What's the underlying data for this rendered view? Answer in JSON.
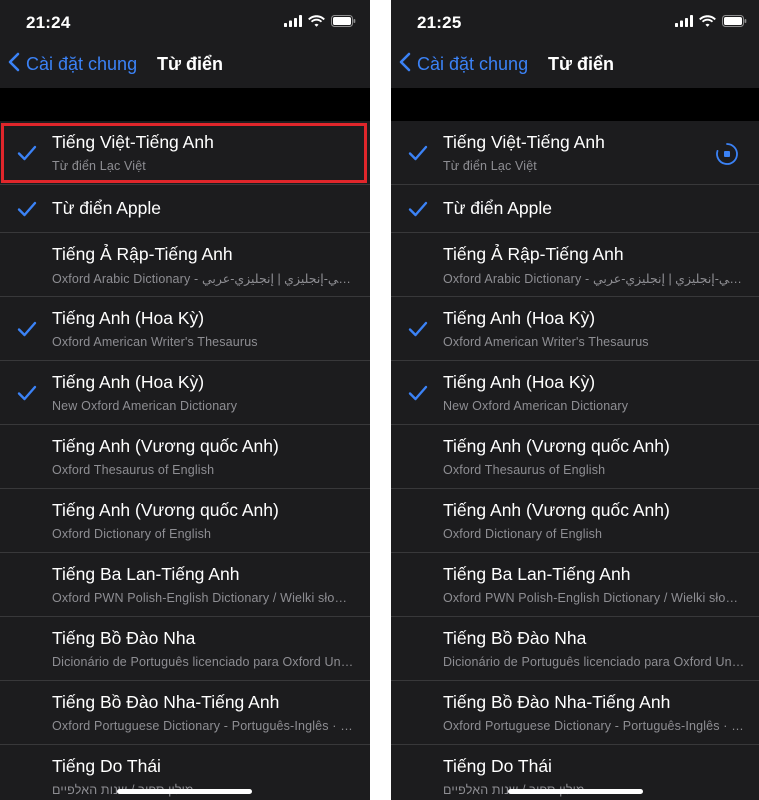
{
  "left": {
    "status_time": "21:24",
    "nav_back_label": "Cài đặt chung",
    "nav_title": "Từ điển",
    "highlighted": true,
    "loading_row": -1
  },
  "right": {
    "status_time": "21:25",
    "nav_back_label": "Cài đặt chung",
    "nav_title": "Từ điển",
    "highlighted": false,
    "loading_row": 0
  },
  "dictionaries": [
    {
      "title": "Tiếng Việt-Tiếng Anh",
      "subtitle": "Từ điển Lạc Việt",
      "checked": true
    },
    {
      "title": "Từ điển Apple",
      "subtitle": "",
      "checked": true
    },
    {
      "title": "Tiếng Ả Rập-Tiếng Anh",
      "subtitle": "Oxford Arabic Dictionary - عربي-إنجليزي | إنجليزي-عربي",
      "checked": false
    },
    {
      "title": "Tiếng Anh (Hoa Kỳ)",
      "subtitle": "Oxford American Writer's Thesaurus",
      "checked": true
    },
    {
      "title": "Tiếng Anh (Hoa Kỳ)",
      "subtitle": "New Oxford American Dictionary",
      "checked": true
    },
    {
      "title": "Tiếng Anh (Vương quốc Anh)",
      "subtitle": "Oxford Thesaurus of English",
      "checked": false
    },
    {
      "title": "Tiếng Anh (Vương quốc Anh)",
      "subtitle": "Oxford Dictionary of English",
      "checked": false
    },
    {
      "title": "Tiếng Ba Lan-Tiếng Anh",
      "subtitle": "Oxford PWN Polish-English Dictionary / Wielki słownik",
      "checked": false
    },
    {
      "title": "Tiếng Bồ Đào Nha",
      "subtitle": "Dicionário de Português licenciado para Oxford University Press",
      "checked": false
    },
    {
      "title": "Tiếng Bồ Đào Nha-Tiếng Anh",
      "subtitle": "Oxford Portuguese Dictionary - Português-Inglês · Inglês-Português",
      "checked": false
    },
    {
      "title": "Tiếng Do Thái",
      "subtitle": "מילון ספיר / שנות האלפיים",
      "checked": false
    }
  ],
  "colors": {
    "background": "#1c1c1e",
    "accent": "#3b82f6",
    "separator": "#38383a",
    "highlight": "#e0262b"
  },
  "icons": {
    "back": "chevron-left-icon",
    "check": "checkmark-icon",
    "loading": "download-progress-icon"
  }
}
